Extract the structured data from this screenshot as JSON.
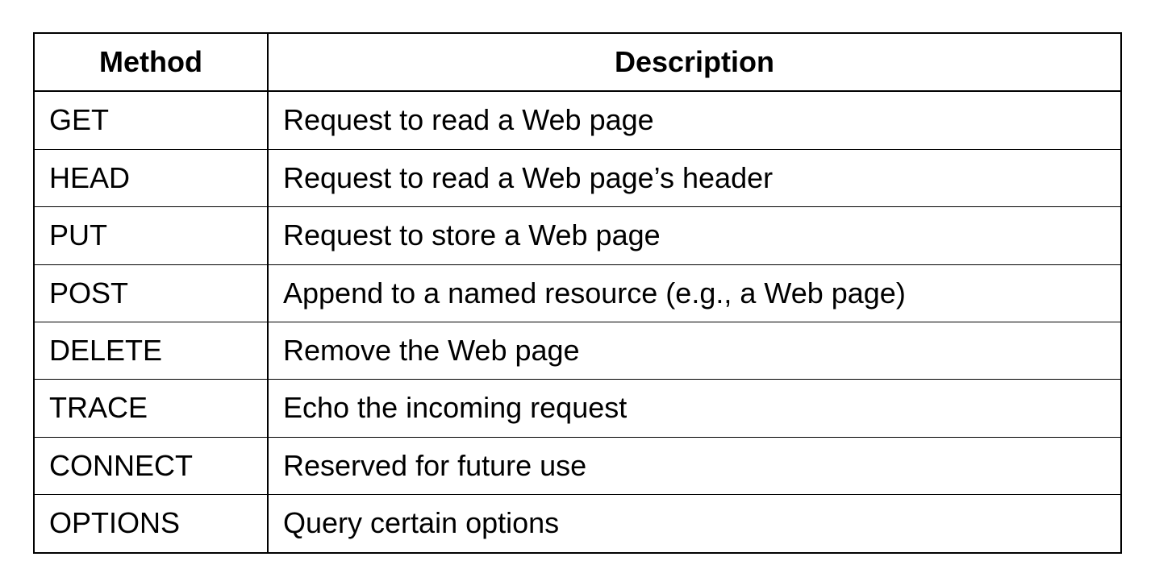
{
  "table": {
    "headers": {
      "method": "Method",
      "description": "Description"
    },
    "rows": [
      {
        "method": "GET",
        "description": "Request to read a Web page"
      },
      {
        "method": "HEAD",
        "description": "Request to read a Web page’s header"
      },
      {
        "method": "PUT",
        "description": "Request to store a Web page"
      },
      {
        "method": "POST",
        "description": "Append to a named resource (e.g., a Web page)"
      },
      {
        "method": "DELETE",
        "description": "Remove the Web page"
      },
      {
        "method": "TRACE",
        "description": "Echo the incoming request"
      },
      {
        "method": "CONNECT",
        "description": "Reserved for future use"
      },
      {
        "method": "OPTIONS",
        "description": "Query certain options"
      }
    ]
  }
}
